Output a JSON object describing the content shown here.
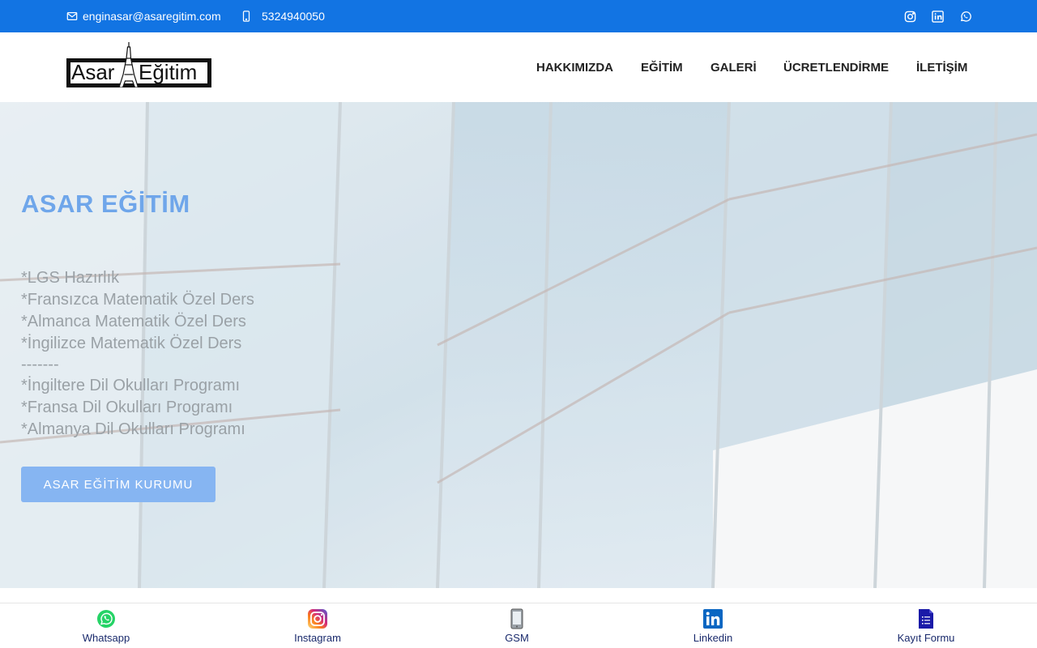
{
  "topbar": {
    "email": "enginasar@asaregitim.com",
    "phone": "5324940050",
    "social_icons": [
      "instagram-icon",
      "linkedin-icon",
      "whatsapp-icon"
    ],
    "background_color": "#1274e3"
  },
  "logo": {
    "word_left": "Asar",
    "word_right": "Eğitim"
  },
  "nav": {
    "items": [
      "HAKKIMIZDA",
      "EĞİTİM",
      "GALERİ",
      "ÜCRETLENDİRME",
      "İLETİŞİM"
    ]
  },
  "hero": {
    "title": "ASAR EĞİTİM",
    "lines": [
      "*LGS Hazırlık",
      "*Fransızca Matematik Özel Ders",
      "*Almanca Matematik Özel Ders",
      "*İngilizce Matematik Özel Ders",
      "-------",
      "*İngiltere Dil Okulları Programı",
      "*Fransa Dil Okulları Programı",
      "*Almanya Dil Okulları Programı"
    ],
    "cta_label": "ASAR EĞİTİM KURUMU",
    "title_color": "#6fa6ea",
    "cta_color": "#86b5f2"
  },
  "bottombar": {
    "items": [
      {
        "label": "Whatsapp",
        "icon": "whatsapp-icon"
      },
      {
        "label": "Instagram",
        "icon": "instagram-icon"
      },
      {
        "label": "GSM",
        "icon": "phone-icon"
      },
      {
        "label": "Linkedin",
        "icon": "linkedin-icon"
      },
      {
        "label": "Kayıt Formu",
        "icon": "form-icon"
      }
    ]
  }
}
